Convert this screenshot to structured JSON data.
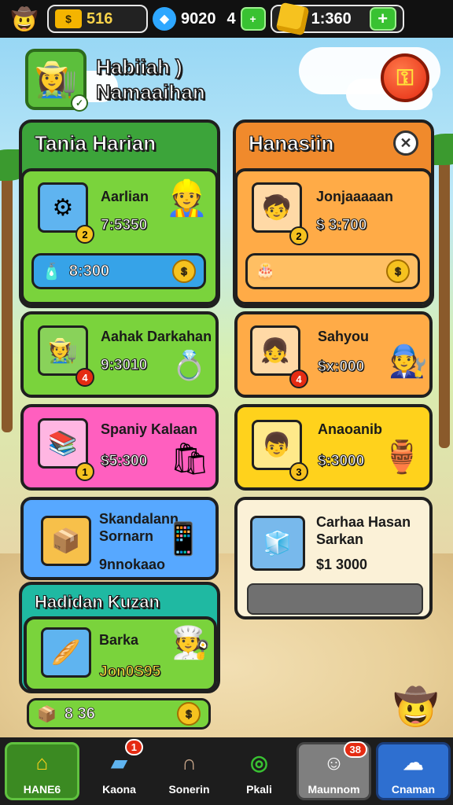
{
  "topbar": {
    "cash": "516",
    "gems": "9020",
    "counter": "4",
    "gold": "1:360"
  },
  "profile": {
    "name_line1": "Habiiah )",
    "name_line2": "Namaaihan"
  },
  "left_panel": {
    "title": "Tania Harian",
    "card1": {
      "name": "Aarlian",
      "value": "7:5350",
      "badge": "2"
    },
    "card1_bar": {
      "value": "8:300"
    },
    "card2": {
      "name": "Aahak Darkahan",
      "value": "9:3010",
      "badge": "4"
    },
    "card3": {
      "name": "Spaniy Kalaan",
      "value": "$5:300",
      "badge": "1"
    },
    "card4": {
      "name1": "Skandalann",
      "name2": "Sornarn",
      "sub": "9nnokaao"
    }
  },
  "right_panel": {
    "title": "Hanasiin",
    "card1": {
      "name": "Jonjaaaaan",
      "value": "$ 3:700",
      "badge": "2"
    },
    "card2": {
      "name": "Sahyou",
      "value": "$x:000",
      "badge": "4"
    },
    "card3": {
      "name": "Anaoanib",
      "value": "$:3000",
      "badge": "3"
    },
    "card4": {
      "name1": "Carhaa Hasan",
      "name2": "Sarkan",
      "value": "$1 3000"
    }
  },
  "bottom_panel": {
    "title": "Hadidan Kuzan",
    "card": {
      "name": "Barka",
      "value": "Jon0S95"
    },
    "bar": {
      "value": "8 36"
    }
  },
  "nav": [
    {
      "label": "HANE6",
      "icon": "home-icon"
    },
    {
      "label": "Kaona",
      "icon": "book-icon",
      "badge": "1"
    },
    {
      "label": "Sonerin",
      "icon": "hook-icon"
    },
    {
      "label": "Pkali",
      "icon": "ring-icon"
    },
    {
      "label": "Maunnom",
      "icon": "cat-icon",
      "badge": "38"
    },
    {
      "label": "Cnaman",
      "icon": "ghost-icon"
    }
  ],
  "colors": {
    "topbar_bg": "#111111",
    "left_panel": "#3ca43a",
    "right_panel": "#f08a2c",
    "accent_red": "#e52b12"
  }
}
